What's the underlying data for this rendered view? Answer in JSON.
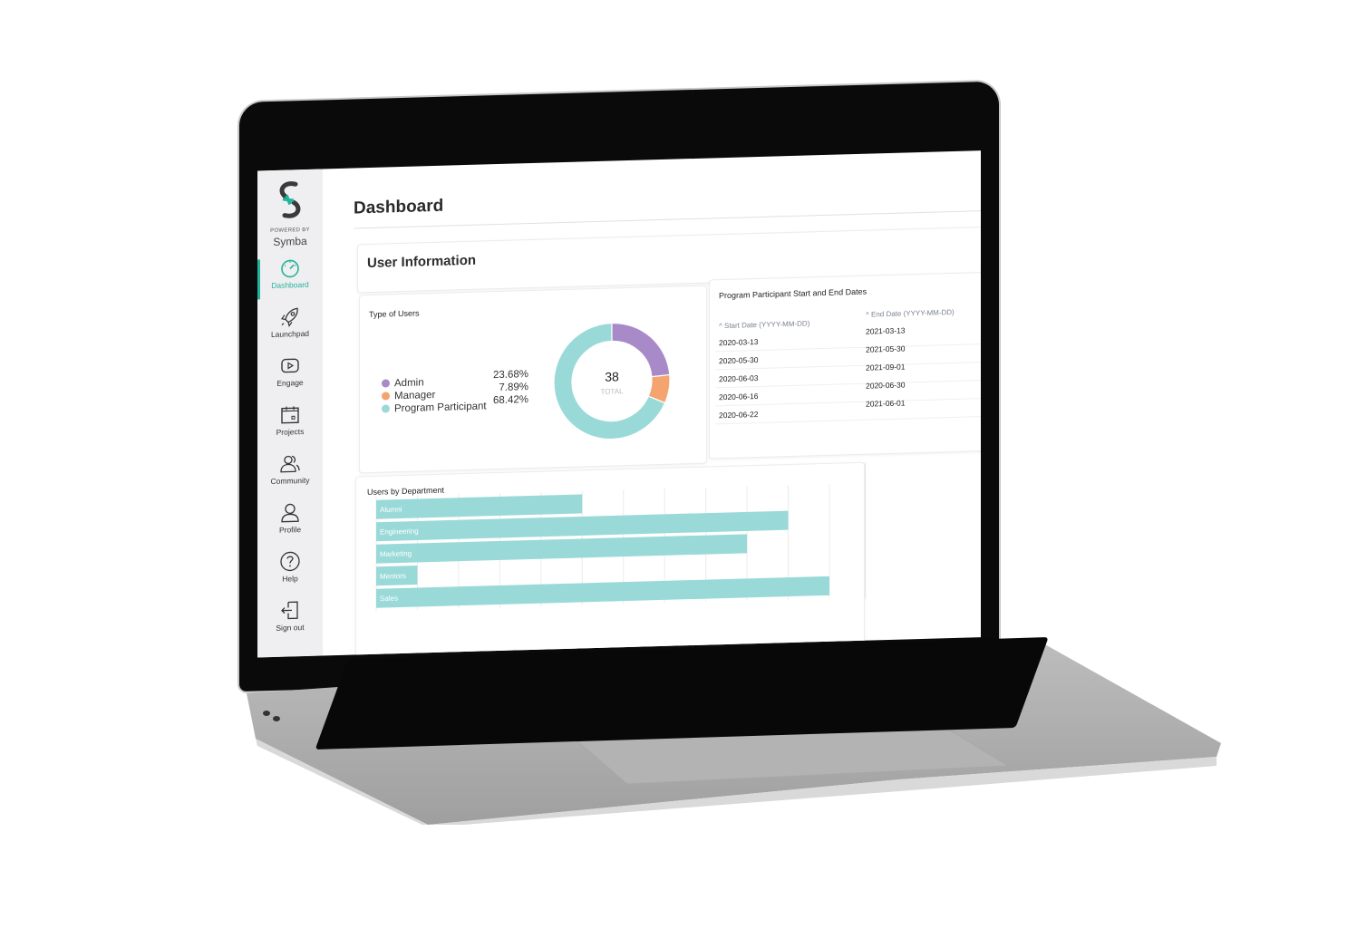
{
  "app": {
    "brand_powered_by": "POWERED BY",
    "brand_name": "Symba",
    "accent_color": "#22b39a"
  },
  "sidebar": {
    "items": [
      {
        "label": "Dashboard",
        "icon": "speedometer-icon",
        "active": true
      },
      {
        "label": "Launchpad",
        "icon": "rocket-icon",
        "active": false
      },
      {
        "label": "Engage",
        "icon": "play-icon",
        "active": false
      },
      {
        "label": "Projects",
        "icon": "calendar-icon",
        "active": false
      },
      {
        "label": "Community",
        "icon": "users-icon",
        "active": false
      },
      {
        "label": "Profile",
        "icon": "user-icon",
        "active": false
      },
      {
        "label": "Help",
        "icon": "question-icon",
        "active": false
      },
      {
        "label": "Sign out",
        "icon": "sign-out-icon",
        "active": false
      }
    ]
  },
  "header": {
    "title": "Dashboard"
  },
  "user_info": {
    "title": "User Information"
  },
  "type_of_users": {
    "title": "Type of Users",
    "total": "38",
    "total_label": "TOTAL",
    "legend": [
      {
        "label": "Admin",
        "pct": "23.68%",
        "color": "#a98ac9"
      },
      {
        "label": "Manager",
        "pct": "7.89%",
        "color": "#f3a46f"
      },
      {
        "label": "Program Participant",
        "pct": "68.42%",
        "color": "#99dad8"
      }
    ]
  },
  "dates": {
    "title": "Program Participant Start and End Dates",
    "start_header": "Start Date (YYYY-MM-DD)",
    "end_header": "End Date (YYYY-MM-DD)",
    "start": [
      "2020-03-13",
      "2020-05-30",
      "2020-06-03",
      "2020-06-16",
      "2020-06-22"
    ],
    "end": [
      "2021-03-13",
      "2021-05-30",
      "2021-09-01",
      "2020-06-30",
      "2021-06-01"
    ]
  },
  "chart_data": [
    {
      "type": "pie",
      "title": "Type of Users",
      "categories": [
        "Admin",
        "Manager",
        "Program Participant"
      ],
      "values": [
        23.68,
        7.89,
        68.42
      ],
      "colors": [
        "#a98ac9",
        "#f3a46f",
        "#99dad8"
      ],
      "center_text": "38",
      "center_subtext": "TOTAL"
    },
    {
      "type": "bar",
      "orientation": "horizontal",
      "title": "Users by Department",
      "categories": [
        "Alumni",
        "Engineering",
        "Marketing",
        "Mentors",
        "Sales"
      ],
      "values": [
        5,
        10,
        9,
        1,
        11
      ],
      "xlim": [
        0,
        11
      ],
      "grid": true,
      "color": "#99dad8"
    }
  ]
}
